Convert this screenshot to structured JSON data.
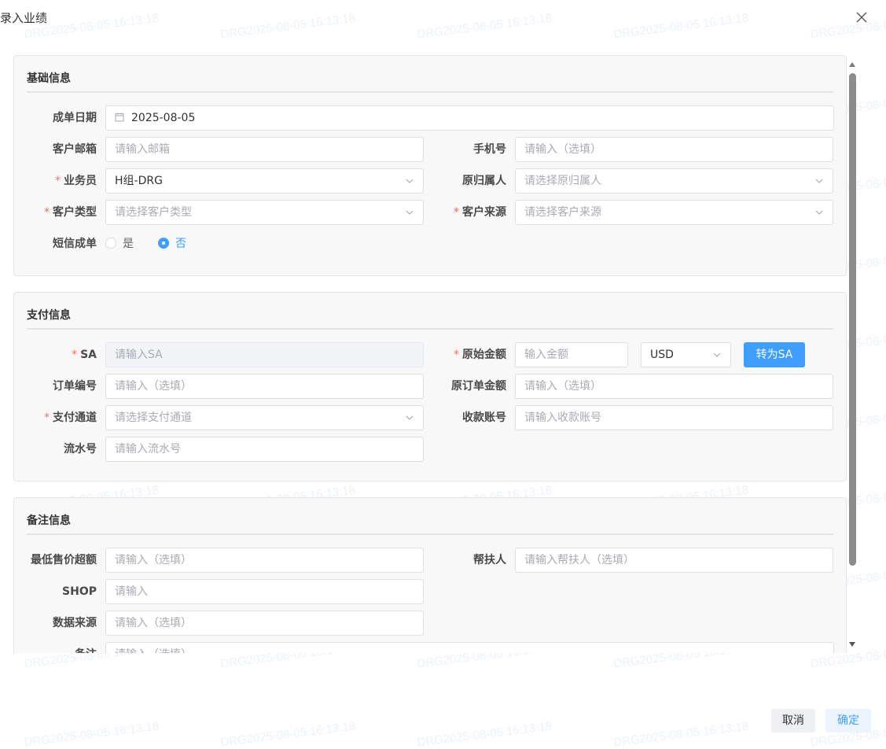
{
  "dialog": {
    "title": "录入业绩"
  },
  "watermark": "DRG2025-08-05 16:13:18",
  "basic": {
    "title": "基础信息",
    "order_date": {
      "label": "成单日期",
      "value": "2025-08-05"
    },
    "email": {
      "label": "客户邮箱",
      "placeholder": "请输入邮箱"
    },
    "phone": {
      "label": "手机号",
      "placeholder": "请输入（选填）"
    },
    "salesperson": {
      "label": "业务员",
      "value": "H组-DRG"
    },
    "original_owner": {
      "label": "原归属人",
      "placeholder": "请选择原归属人"
    },
    "customer_type": {
      "label": "客户类型",
      "placeholder": "请选择客户类型"
    },
    "customer_source": {
      "label": "客户来源",
      "placeholder": "请选择客户来源"
    },
    "sms_order": {
      "label": "短信成单",
      "option_yes": "是",
      "option_no": "否",
      "selected": "否"
    }
  },
  "payment": {
    "title": "支付信息",
    "sa": {
      "label": "SA",
      "placeholder": "请输入SA"
    },
    "original_amount": {
      "label": "原始金额",
      "placeholder": "输入金额",
      "currency": "USD"
    },
    "convert_button": "转为SA",
    "order_no": {
      "label": "订单编号",
      "placeholder": "请输入（选填）"
    },
    "original_order_amount": {
      "label": "原订单金额",
      "placeholder": "请输入（选填）"
    },
    "pay_channel": {
      "label": "支付通道",
      "placeholder": "请选择支付通道"
    },
    "receiving_account": {
      "label": "收款账号",
      "placeholder": "请输入收款账号"
    },
    "serial_no": {
      "label": "流水号",
      "placeholder": "请输入流水号"
    }
  },
  "remark": {
    "title": "备注信息",
    "min_price_excess": {
      "label": "最低售价超额",
      "placeholder": "请输入（选填）"
    },
    "helper": {
      "label": "帮扶人",
      "placeholder": "请输入帮扶人（选填）"
    },
    "shop": {
      "label": "SHOP",
      "placeholder": "请输入"
    },
    "data_source": {
      "label": "数据来源",
      "placeholder": "请输入（选填）"
    },
    "note": {
      "label": "备注",
      "placeholder": "请输入（选填）"
    }
  },
  "footer": {
    "cancel": "取消",
    "confirm": "确定"
  },
  "colors": {
    "primary": "#409eff",
    "required": "#f56c6c",
    "section_bg": "#f8f8f8"
  }
}
